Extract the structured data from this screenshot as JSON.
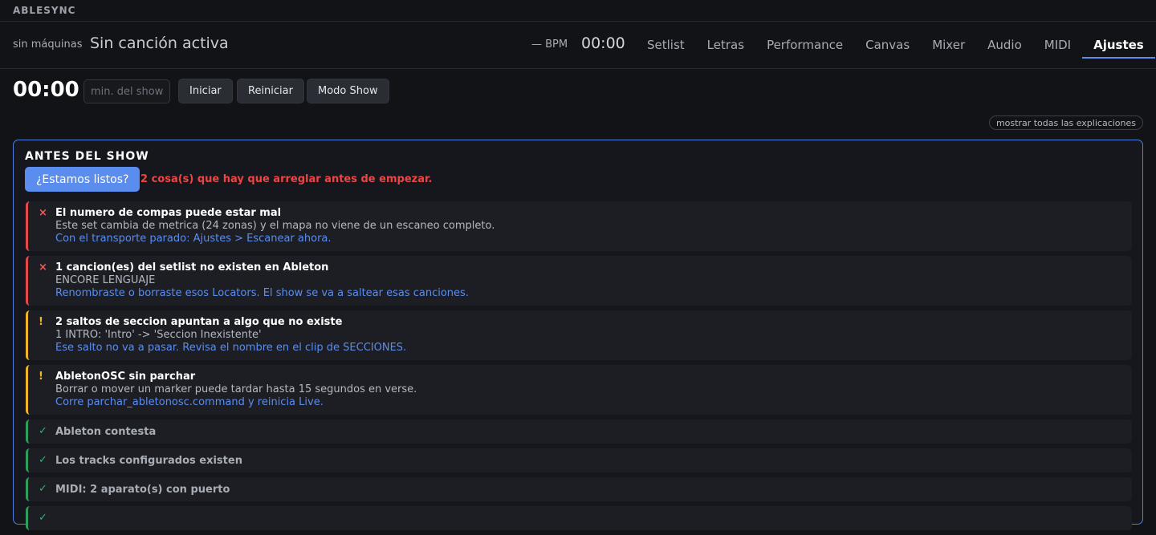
{
  "brand": "ABLESYNC",
  "header": {
    "machines": "sin máquinas",
    "song": "Sin canción activa",
    "bpm": "— BPM",
    "clock": "00:00",
    "tabs": [
      {
        "label": "Setlist"
      },
      {
        "label": "Letras"
      },
      {
        "label": "Performance"
      },
      {
        "label": "Canvas"
      },
      {
        "label": "Mixer"
      },
      {
        "label": "Audio"
      },
      {
        "label": "MIDI"
      },
      {
        "label": "Ajustes",
        "active": true
      }
    ]
  },
  "toolbar": {
    "timer": "00:00",
    "duration_placeholder": "min. del show",
    "start_label": "Iniciar",
    "reset_label": "Reiniciar",
    "show_mode_label": "Modo Show",
    "explain_all_label": "mostrar todas las explicaciones"
  },
  "preshow": {
    "title": "ANTES DEL SHOW",
    "ready_button": "¿Estamos listos?",
    "ready_message": "2 cosa(s) que hay que arreglar antes de empezar.",
    "checks": [
      {
        "status": "error",
        "mark": "×",
        "title": "El numero de compas puede estar mal",
        "detail": "Este set cambia de metrica (24 zonas) y el mapa no viene de un escaneo completo.",
        "fix": "Con el transporte parado: Ajustes > Escanear ahora."
      },
      {
        "status": "error",
        "mark": "×",
        "title": "1 cancion(es) del setlist no existen en Ableton",
        "detail": "ENCORE LENGUAJE",
        "fix": "Renombraste o borraste esos Locators. El show se va a saltear esas canciones."
      },
      {
        "status": "warn",
        "mark": "!",
        "title": "2 saltos de seccion apuntan a algo que no existe",
        "detail": "1 INTRO: 'Intro' -> 'Seccion Inexistente'",
        "fix": "Ese salto no va a pasar. Revisa el nombre en el clip de SECCIONES."
      },
      {
        "status": "warn",
        "mark": "!",
        "title": "AbletonOSC sin parchar",
        "detail": "Borrar o mover un marker puede tardar hasta 15 segundos en verse.",
        "fix": "Corre parchar_abletonosc.command y reinicia Live."
      },
      {
        "status": "ok",
        "mark": "✓",
        "title": "Ableton contesta"
      },
      {
        "status": "ok",
        "mark": "✓",
        "title": "Los tracks configurados existen"
      },
      {
        "status": "ok",
        "mark": "✓",
        "title": "MIDI: 2 aparato(s) con puerto"
      },
      {
        "status": "ok",
        "mark": "✓",
        "title": ""
      }
    ]
  },
  "colors": {
    "background": "#111317",
    "accent": "#5b8def",
    "error": "#ef4444",
    "warning": "#f0b429",
    "ok": "#2f9e5a"
  }
}
